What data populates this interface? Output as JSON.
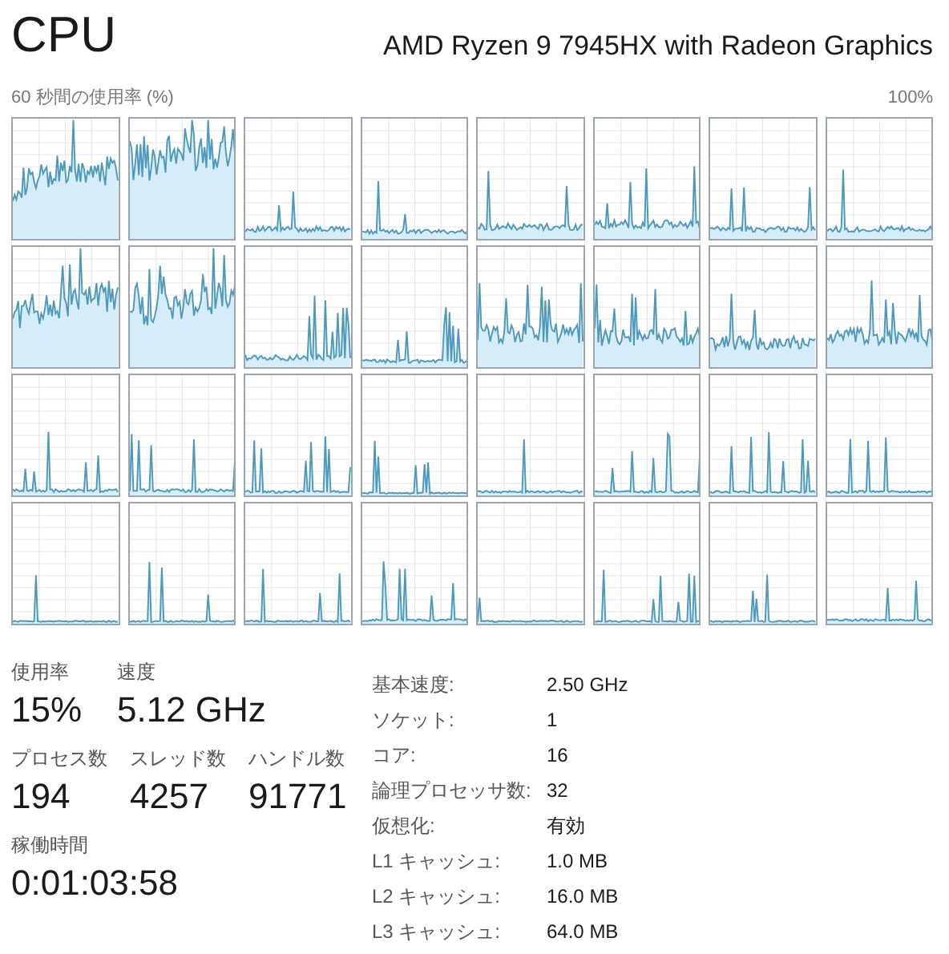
{
  "title": "CPU",
  "model": "AMD Ryzen 9 7945HX with Radeon Graphics",
  "graph_caption": "60 秒間の使用率 (%)",
  "graph_max": "100%",
  "stats": [
    [
      {
        "label": "使用率",
        "value": "15%"
      },
      {
        "label": "速度",
        "value": "5.12 GHz"
      }
    ],
    [
      {
        "label": "プロセス数",
        "value": "194"
      },
      {
        "label": "スレッド数",
        "value": "4257"
      },
      {
        "label": "ハンドル数",
        "value": "91771"
      }
    ],
    [
      {
        "label": "稼働時間",
        "value": "0:01:03:58"
      }
    ]
  ],
  "details": [
    {
      "label": "基本速度:",
      "value": "2.50 GHz"
    },
    {
      "label": "ソケット:",
      "value": "1"
    },
    {
      "label": "コア:",
      "value": "16"
    },
    {
      "label": "論理プロセッサ数:",
      "value": "32"
    },
    {
      "label": "仮想化:",
      "value": "有効"
    },
    {
      "label": "L1 キャッシュ:",
      "value": "1.0 MB"
    },
    {
      "label": "L2 キャッシュ:",
      "value": "16.0 MB"
    },
    {
      "label": "L3 キャッシュ:",
      "value": "64.0 MB"
    }
  ]
}
